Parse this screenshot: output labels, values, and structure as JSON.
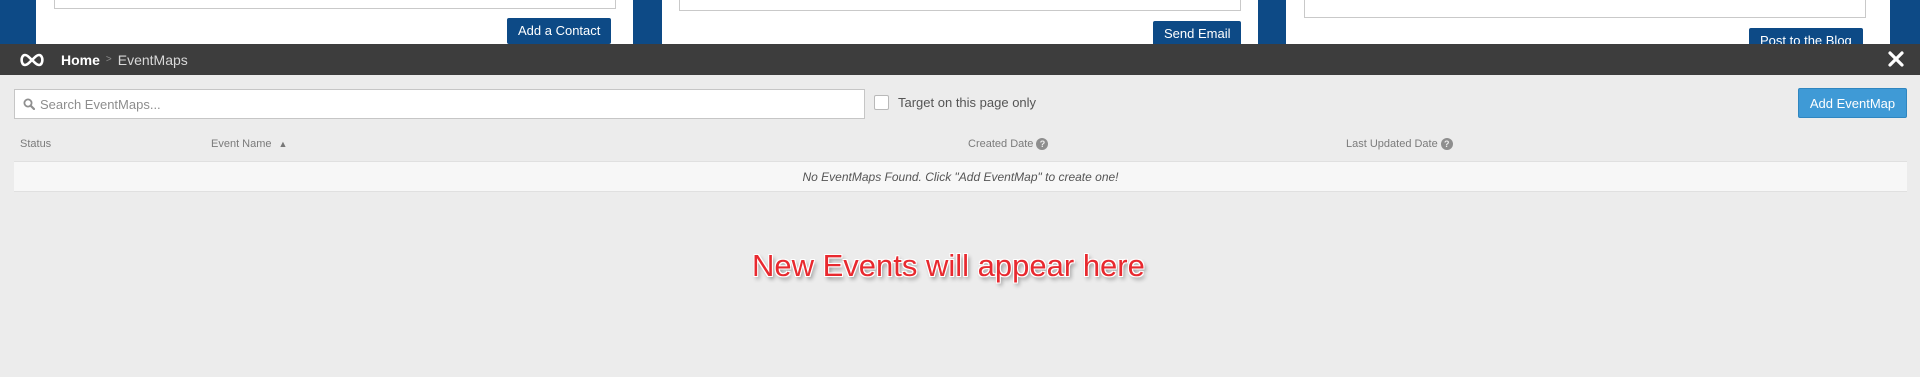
{
  "background": {
    "add_contact_label": "Add a Contact",
    "send_email_label": "Send Email",
    "post_blog_label": "Post to the Blog"
  },
  "header": {
    "logo_icon": "infinity-logo-icon",
    "breadcrumb_home": "Home",
    "breadcrumb_separator": ">",
    "breadcrumb_current": "EventMaps",
    "close_icon": "close-icon"
  },
  "toolbar": {
    "search_placeholder": "Search EventMaps...",
    "search_value": "",
    "target_checkbox_checked": false,
    "target_label": "Target on this page only",
    "add_button_label": "Add EventMap"
  },
  "table": {
    "columns": [
      {
        "label": "Status",
        "sort": ""
      },
      {
        "label": "Event Name",
        "sort": "▲"
      },
      {
        "label": "Created Date",
        "help": "?"
      },
      {
        "label": "Last Updated Date",
        "help": "?"
      }
    ],
    "empty_message": "No EventMaps Found. Click \"Add EventMap\" to create one!"
  },
  "annotation": {
    "text": "New Events will appear here"
  },
  "colors": {
    "header_bg": "#3d3d3d",
    "page_bg": "#ececec",
    "accent_blue": "#3f9ad6",
    "background_blue": "#0d4a86",
    "annotation_red": "#e8292f"
  }
}
